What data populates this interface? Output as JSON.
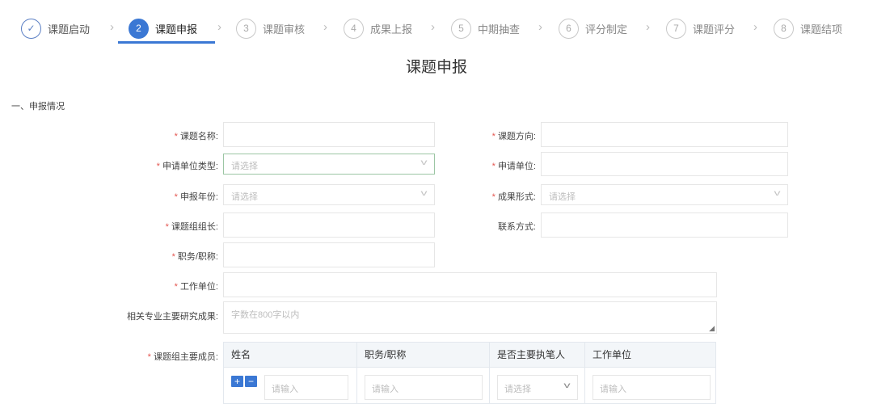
{
  "steps": [
    {
      "num": "✓",
      "label": "课题启动",
      "state": "done"
    },
    {
      "num": "2",
      "label": "课题申报",
      "state": "active"
    },
    {
      "num": "3",
      "label": "课题审核",
      "state": "todo"
    },
    {
      "num": "4",
      "label": "成果上报",
      "state": "todo"
    },
    {
      "num": "5",
      "label": "中期抽查",
      "state": "todo"
    },
    {
      "num": "6",
      "label": "评分制定",
      "state": "todo"
    },
    {
      "num": "7",
      "label": "课题评分",
      "state": "todo"
    },
    {
      "num": "8",
      "label": "课题结项",
      "state": "todo"
    }
  ],
  "page_title": "课题申报",
  "section_title": "一、申报情况",
  "form": {
    "topic_name_label": "课题名称:",
    "topic_direction_label": "课题方向:",
    "unit_type_label": "申请单位类型:",
    "unit_type_placeholder": "请选择",
    "applicant_unit_label": "申请单位:",
    "apply_year_label": "申报年份:",
    "apply_year_placeholder": "请选择",
    "result_form_label": "成果形式:",
    "result_form_placeholder": "请选择",
    "leader_label": "课题组组长:",
    "contact_label": "联系方式:",
    "title_label": "职务/职称:",
    "work_unit_label": "工作单位:",
    "research_label": "相关专业主要研究成果:",
    "research_placeholder": "字数在800字以内",
    "members_label": "课题组主要成员:"
  },
  "members": {
    "headers": [
      "姓名",
      "职务/职称",
      "是否主要执笔人",
      "工作单位"
    ],
    "add_symbol": "+",
    "remove_symbol": "−",
    "name_placeholder": "请输入",
    "title_placeholder": "请输入",
    "writer_placeholder": "请选择",
    "unit_placeholder": "请输入"
  },
  "required_mark": "*",
  "colors": {
    "accent": "#3b78d4",
    "required": "#e3554f"
  }
}
